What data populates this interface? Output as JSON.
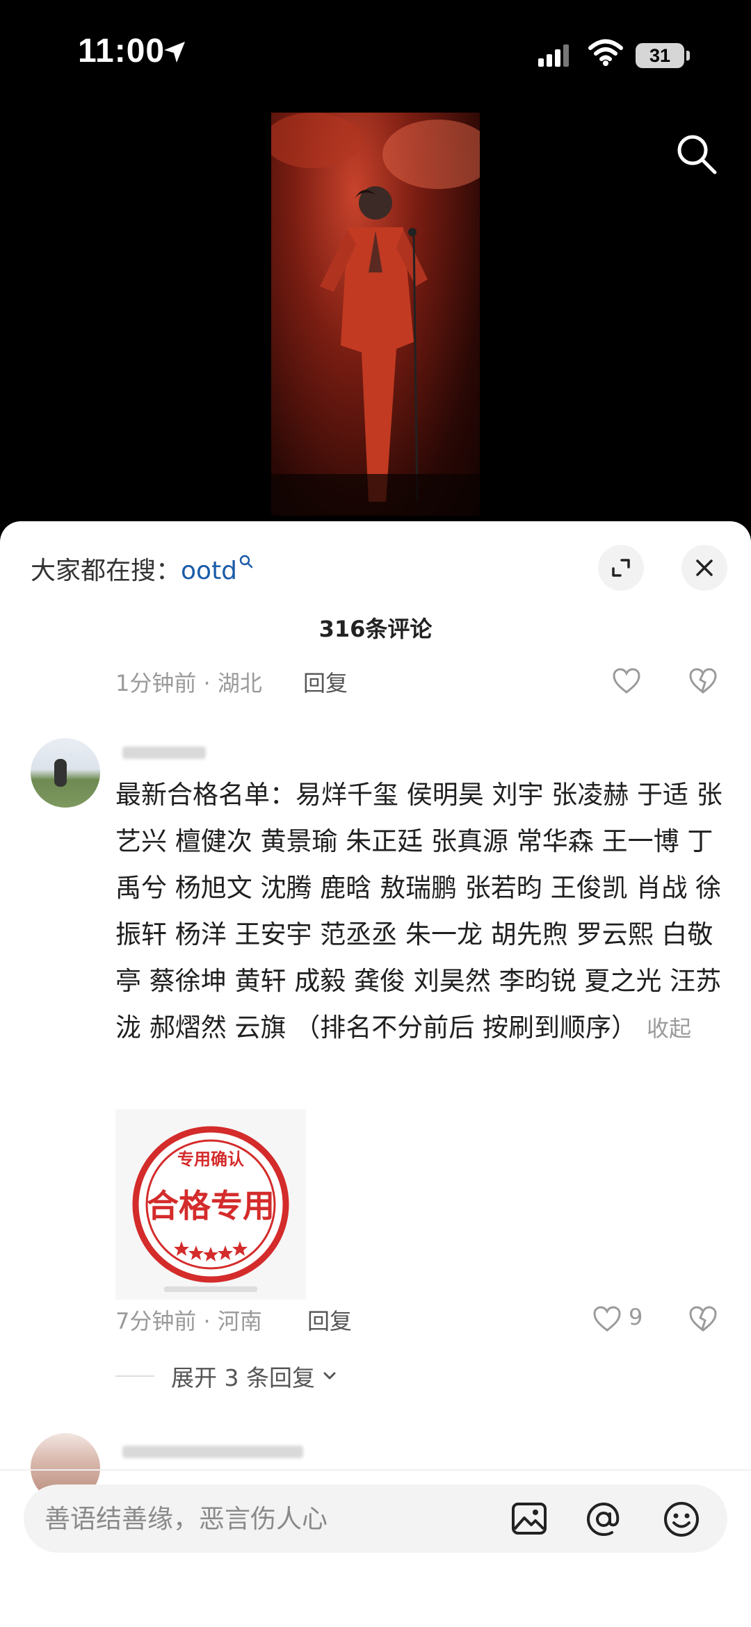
{
  "status_bar": {
    "time": "11:00",
    "battery": "31"
  },
  "sheet": {
    "hot_search_label": "大家都在搜：",
    "hot_search_keyword": "ootd",
    "comment_count": "316条评论"
  },
  "prev_comment": {
    "meta": "1分钟前 · 湖北",
    "reply": "回复"
  },
  "comment": {
    "text": "最新合格名单：易烊千玺 侯明昊  刘宇 张凌赫 于适  张艺兴  檀健次 黄景瑜 朱正廷 张真源 常华森 王一博 丁禹兮 杨旭文 沈腾 鹿晗 敖瑞鹏 张若昀 王俊凯 肖战  徐振轩 杨洋 王安宇 范丞丞 朱一龙 胡先煦 罗云熙 白敬亭 蔡徐坤 黄轩 成毅 龚俊 刘昊然 李昀锐 夏之光 汪苏泷 郝熠然 云旗 （排名不分前后 按刷到顺序）",
    "collapse": "收起",
    "stamp_top": "专用确认",
    "stamp_main": "合格专用",
    "meta": "7分钟前 · 河南",
    "reply": "回复",
    "likes": "9",
    "expand_replies": "展开 3 条回复"
  },
  "input": {
    "placeholder": "善语结善缘，恶言伤人心"
  },
  "colors": {
    "keyword": "#1a5ba8",
    "stamp": "#d42b2b",
    "meta": "#9a9a9a"
  }
}
